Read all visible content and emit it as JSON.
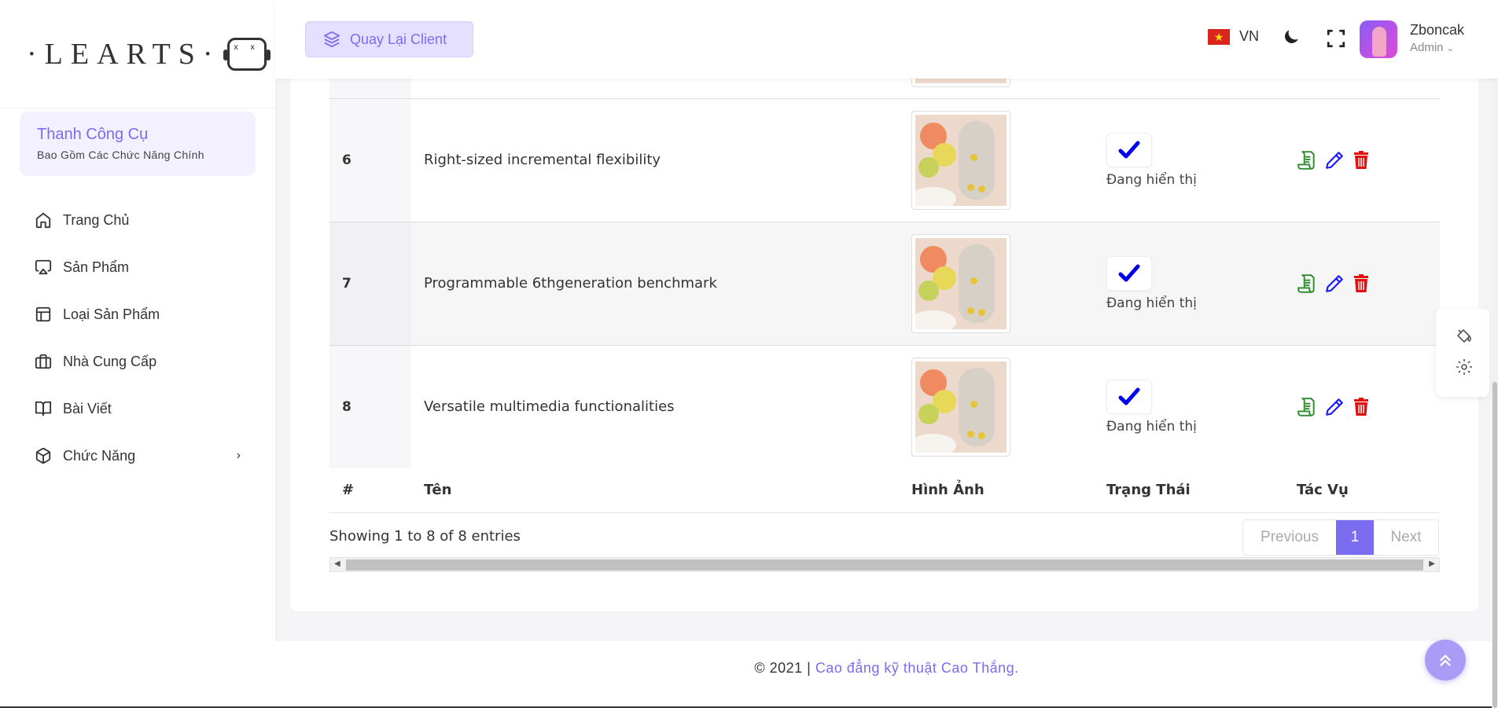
{
  "brand": {
    "logo_text": "·LEARTS·",
    "robot_eyes": "x x"
  },
  "toolbox": {
    "title": "Thanh Công Cụ",
    "subtitle": "Bao Gồm Các Chức Năng Chính"
  },
  "sidebar": {
    "items": [
      {
        "label": "Trang Chủ",
        "icon": "home-icon"
      },
      {
        "label": "Sản Phẩm",
        "icon": "airplay-icon"
      },
      {
        "label": "Loại Sản Phẩm",
        "icon": "layout-icon"
      },
      {
        "label": "Nhà Cung Cấp",
        "icon": "briefcase-icon"
      },
      {
        "label": "Bài Viết",
        "icon": "book-open-icon"
      },
      {
        "label": "Chức Năng",
        "icon": "box-icon",
        "chevron": "›"
      }
    ]
  },
  "header": {
    "back_label": "Quay Lại Client",
    "lang": "VN",
    "user_name": "Zboncak",
    "user_role": "Admin"
  },
  "table": {
    "rows": [
      {
        "index": "6",
        "name": "Right-sized incremental flexibility",
        "status": "Đang hiển thị"
      },
      {
        "index": "7",
        "name": "Programmable 6thgeneration benchmark",
        "status": "Đang hiển thị"
      },
      {
        "index": "8",
        "name": "Versatile multimedia functionalities",
        "status": "Đang hiển thị"
      }
    ],
    "columns": {
      "index": "#",
      "name": "Tên",
      "image": "Hình Ảnh",
      "status": "Trạng Thái",
      "actions": "Tác Vụ"
    }
  },
  "pagination": {
    "info": "Showing 1 to 8 of 8 entries",
    "previous": "Previous",
    "current": "1",
    "next": "Next"
  },
  "footer": {
    "copyright": "© 2021 | ",
    "link": "Cao đẳng kỹ thuật Cao Thắng."
  },
  "colors": {
    "accent": "#7b6cf0",
    "check": "#0000ee",
    "view_icon": "#2e8b2e",
    "edit_icon": "#1a1aff",
    "delete_icon": "#e01010"
  }
}
